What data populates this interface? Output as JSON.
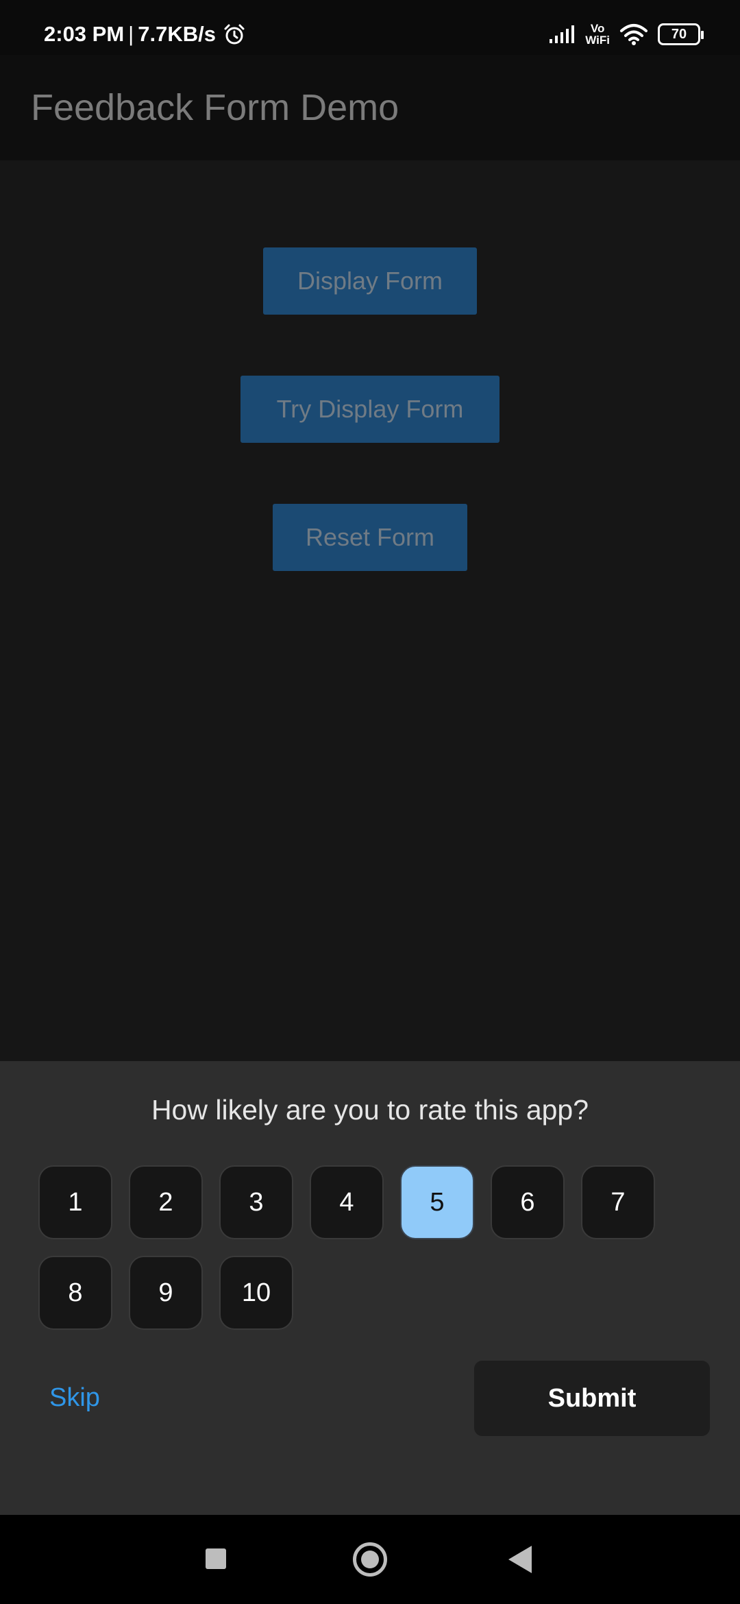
{
  "status_bar": {
    "time": "2:03 PM",
    "separator": "|",
    "network_speed": "7.7KB/s",
    "vowifi_top": "Vo",
    "vowifi_bottom": "WiFi",
    "battery": "70",
    "icons": [
      "alarm-icon",
      "signal-icon",
      "vowifi-icon",
      "wifi-icon",
      "battery-icon"
    ]
  },
  "app_bar": {
    "title": "Feedback Form Demo"
  },
  "main": {
    "buttons": [
      {
        "label": "Display Form"
      },
      {
        "label": "Try Display Form"
      },
      {
        "label": "Reset Form"
      }
    ]
  },
  "sheet": {
    "question": "How likely are you to rate this app?",
    "ratings": [
      "1",
      "2",
      "3",
      "4",
      "5",
      "6",
      "7",
      "8",
      "9",
      "10"
    ],
    "selected_rating": "5",
    "skip_label": "Skip",
    "submit_label": "Submit"
  },
  "nav_bar": {
    "icons": [
      "recents-icon",
      "home-icon",
      "back-icon"
    ]
  },
  "colors": {
    "background": "#161616",
    "primary_button": "#1b4a73",
    "selected_rating": "#90caf9",
    "link": "#2f96e8"
  }
}
